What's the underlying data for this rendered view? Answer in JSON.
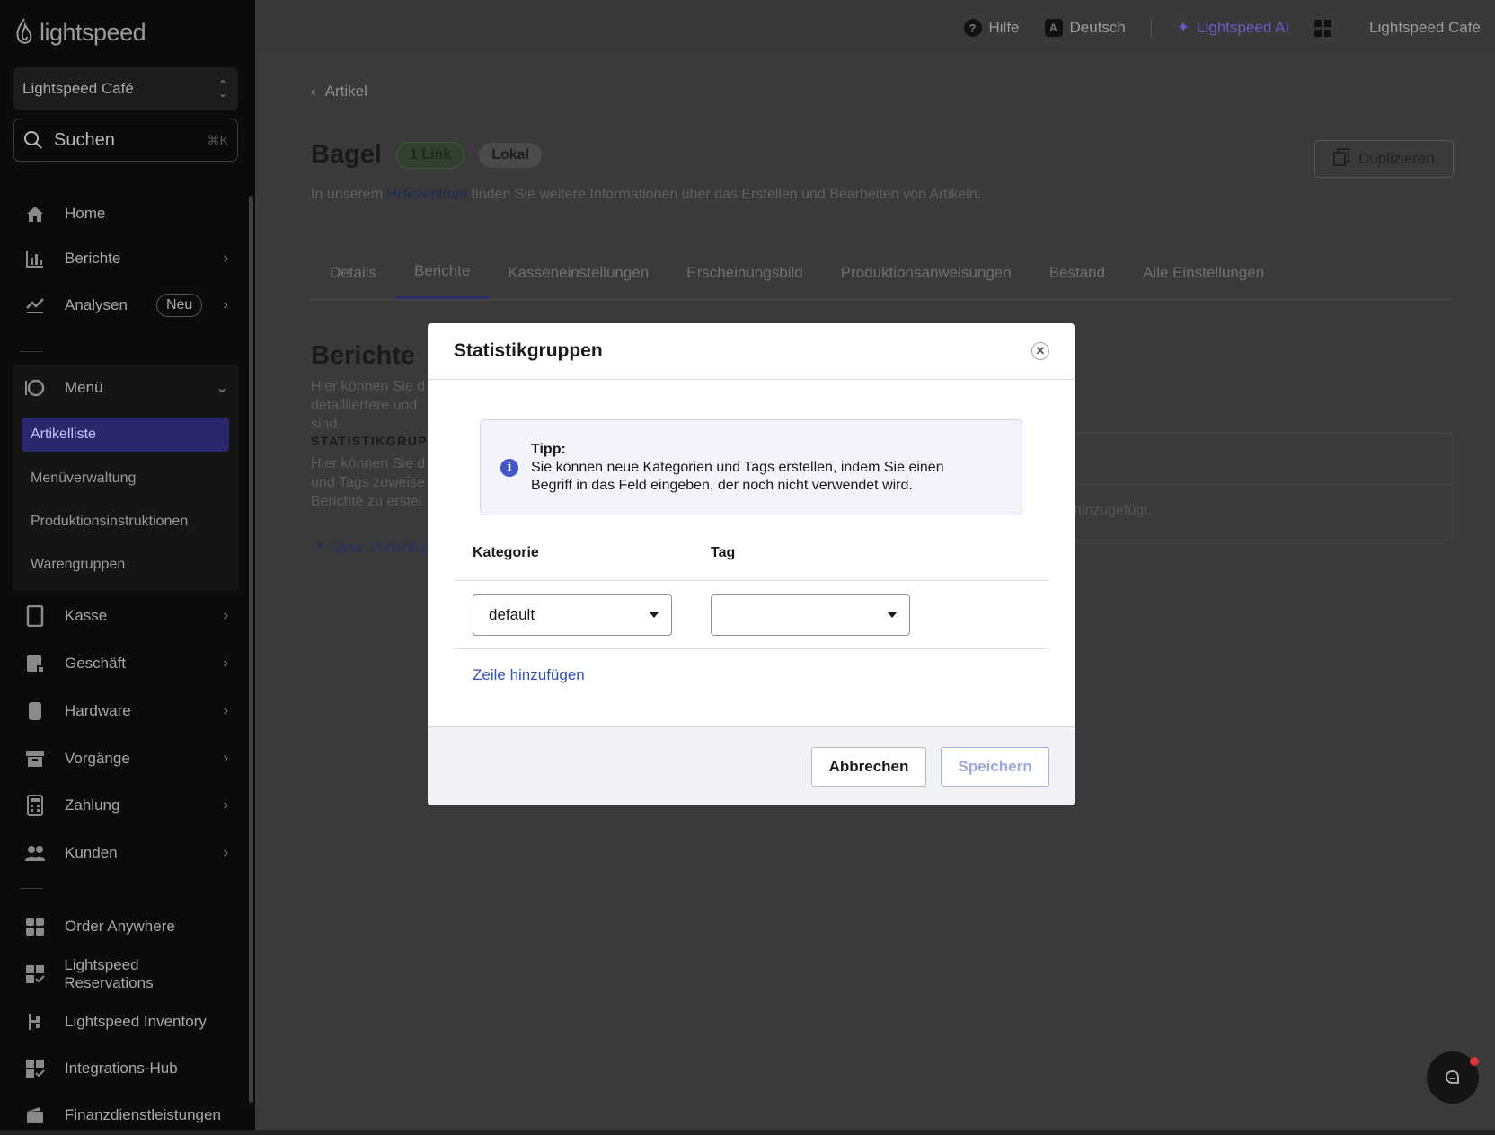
{
  "brand": {
    "logo_text": "lightspeed"
  },
  "sidebar": {
    "store": "Lightspeed Café",
    "search": {
      "placeholder": "Suchen",
      "shortcut": "⌘K"
    },
    "items": [
      {
        "label": "Home",
        "icon": "home-icon"
      },
      {
        "label": "Berichte",
        "icon": "bar-chart-icon"
      },
      {
        "label": "Analysen",
        "icon": "trend-icon",
        "badge": "Neu"
      },
      {
        "label": "Menü",
        "icon": "menu-dish-icon"
      },
      {
        "label": "Kasse",
        "icon": "tablet-icon"
      },
      {
        "label": "Geschäft",
        "icon": "store-icon"
      },
      {
        "label": "Hardware",
        "icon": "hardware-icon"
      },
      {
        "label": "Vorgänge",
        "icon": "archive-icon"
      },
      {
        "label": "Zahlung",
        "icon": "calculator-icon"
      },
      {
        "label": "Kunden",
        "icon": "users-icon"
      },
      {
        "label": "Order Anywhere",
        "icon": "order-icon"
      },
      {
        "label": "Lightspeed Reservations",
        "icon": "reservations-icon"
      },
      {
        "label": "Lightspeed Inventory",
        "icon": "inventory-icon"
      },
      {
        "label": "Integrations-Hub",
        "icon": "integrations-icon"
      },
      {
        "label": "Finanzdienstleistungen",
        "icon": "wallet-icon"
      }
    ],
    "menu_sub": [
      {
        "label": "Artikelliste",
        "active": true
      },
      {
        "label": "Menüverwaltung"
      },
      {
        "label": "Produktionsinstruktionen"
      },
      {
        "label": "Warengruppen"
      }
    ]
  },
  "topbar": {
    "help": "Hilfe",
    "language": "Deutsch",
    "ai": "Lightspeed AI",
    "account": "Lightspeed Café"
  },
  "page": {
    "back": "Artikel",
    "title": "Bagel",
    "pill_link": "1 Link",
    "pill_local": "Lokal",
    "duplicate": "Duplizieren",
    "help_prefix": "In unserem ",
    "help_link": "Hilfezentrum",
    "help_suffix": " finden Sie weitere Informationen über das Erstellen und Bearbeiten von Artikeln.",
    "tabs": [
      "Details",
      "Berichte",
      "Kasseneinstellungen",
      "Erscheinungsbild",
      "Produktionsanweisungen",
      "Bestand",
      "Alle Einstellungen"
    ],
    "active_tab": "Berichte",
    "section_title": "Berichte",
    "section_p1": [
      "Hier können Sie d",
      "detailliertere und",
      "sind."
    ],
    "section_caption": "STATISTIKGRUPPEN",
    "section_p2": [
      "Hier können Sie d",
      "und Tags zuweise",
      "Berichte zu erstel"
    ],
    "ext_link": "Über Statistikgruppen",
    "card_text": "hinzugefügt."
  },
  "modal": {
    "title": "Statistikgruppen",
    "tip_title": "Tipp:",
    "tip_line1": "Sie können neue Kategorien und Tags erstellen, indem Sie einen",
    "tip_line2": "Begriff in das Feld eingeben, der noch nicht verwendet wird.",
    "col_category": "Kategorie",
    "col_tag": "Tag",
    "category_value": "default",
    "tag_value": "",
    "add_row": "Zeile hinzufügen",
    "cancel": "Abbrechen",
    "save": "Speichern"
  },
  "colors": {
    "sidebar_bg": "#0b0b0b",
    "active_item_bg": "#2a276b",
    "link": "#2b4fc7",
    "ai_accent": "#6a5bc9",
    "notification": "#dd3333"
  }
}
